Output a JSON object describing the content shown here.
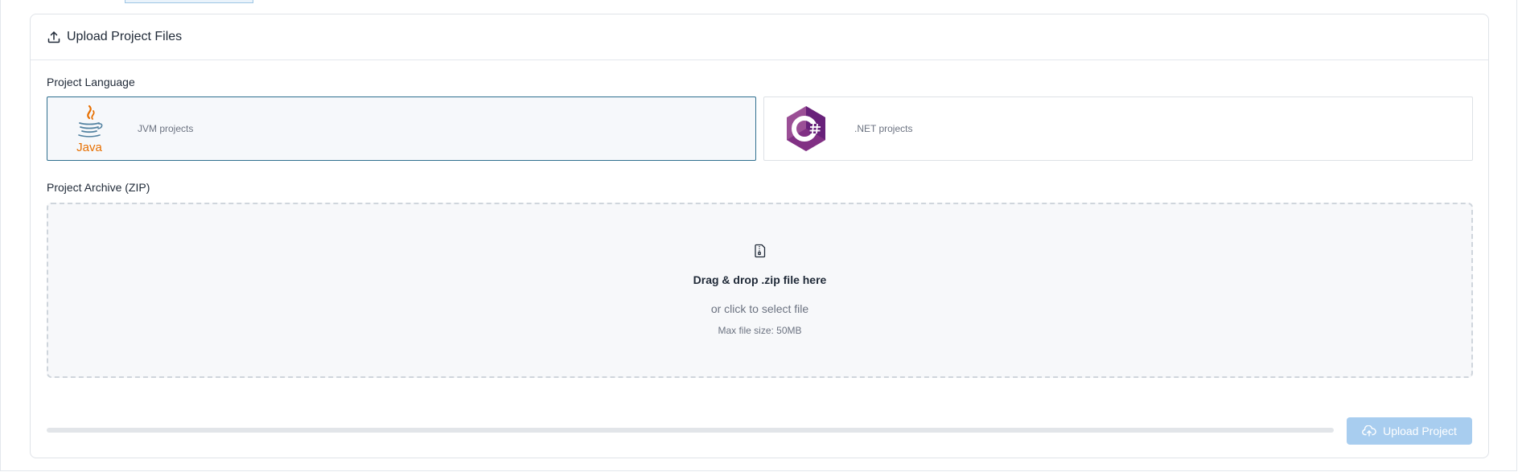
{
  "header": {
    "title": "Upload Project Files",
    "icon": "upload-icon"
  },
  "language": {
    "label": "Project Language",
    "options": [
      {
        "id": "jvm",
        "label": "JVM projects",
        "logo_text": "Java",
        "icon": "java-logo",
        "selected": true
      },
      {
        "id": "dotnet",
        "label": ".NET projects",
        "icon": "csharp-logo",
        "selected": false
      }
    ]
  },
  "archive": {
    "label": "Project Archive (ZIP)",
    "drop_title": "Drag & drop .zip file here",
    "drop_subtitle": "or click to select file",
    "max_size": "Max file size: 50MB",
    "icon": "zip-file-icon"
  },
  "progress": {
    "value": 0
  },
  "actions": {
    "upload_label": "Upload Project",
    "upload_icon": "cloud-upload-icon",
    "upload_enabled": false
  },
  "colors": {
    "accent_selected_border": "#2f6f8f",
    "button_disabled": "#a8cdef",
    "java_orange": "#e76f00",
    "java_blue": "#5382a1",
    "csharp_purple": "#68217a"
  }
}
